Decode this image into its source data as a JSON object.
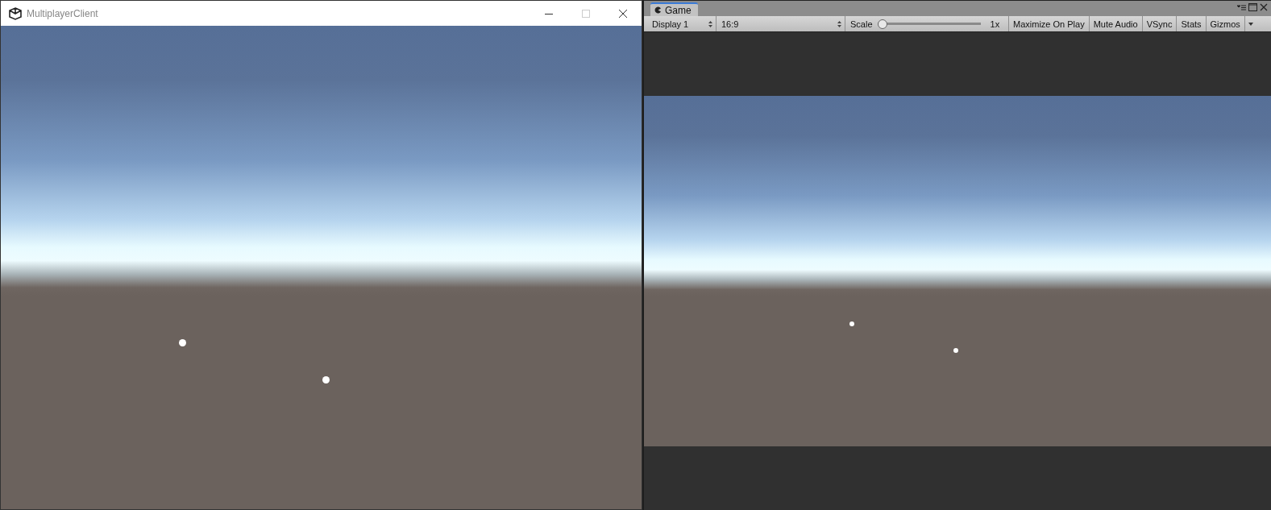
{
  "client_window": {
    "title": "MultiplayerClient"
  },
  "game_panel": {
    "tabs": [
      {
        "label": "Game",
        "selected": true
      }
    ],
    "toolbar": {
      "display": "Display 1",
      "aspect": "16:9",
      "scale_label": "Scale",
      "scale": {
        "level": 0
      },
      "scale_reading": "1x",
      "toggles": [
        {
          "label": "Maximize On Play",
          "on": false
        },
        {
          "label": "Mute Audio",
          "on": false
        },
        {
          "label": "VSync",
          "on": false
        },
        {
          "label": "Stats",
          "on": false
        },
        {
          "label": "Gizmos",
          "on": false
        }
      ]
    }
  }
}
